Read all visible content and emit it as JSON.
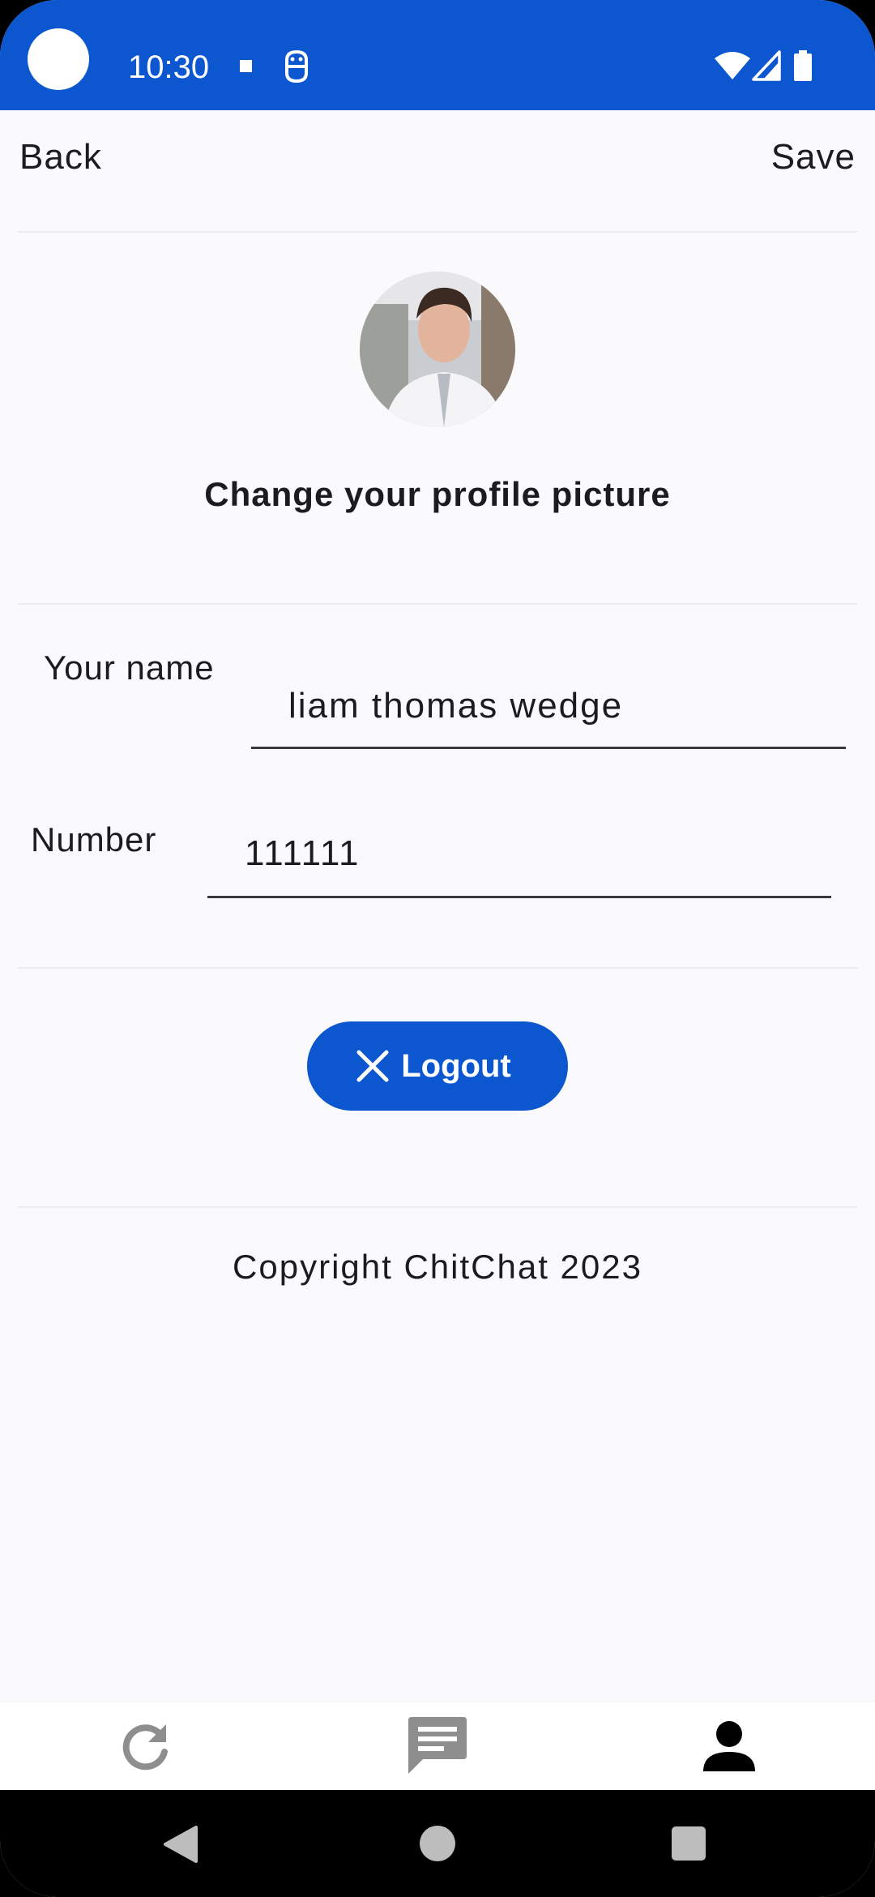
{
  "status_bar": {
    "time": "10:30",
    "color": "#0c57d0",
    "icons": [
      "notification-dot-icon",
      "notification-app-icon",
      "wifi-icon",
      "signal-icon",
      "battery-icon"
    ]
  },
  "header": {
    "back_label": "Back",
    "save_label": "Save"
  },
  "profile": {
    "change_picture_label": "Change your profile picture"
  },
  "form": {
    "name_label": "Your name",
    "name_value": "liam thomas wedge",
    "number_label": "Number",
    "number_value": "111111"
  },
  "logout": {
    "label": "Logout",
    "icon": "close-icon",
    "color": "#0c57d0"
  },
  "footer": {
    "copyright": "Copyright ChitChat 2023"
  },
  "bottom_nav": {
    "items": [
      {
        "icon": "refresh-icon",
        "active": false
      },
      {
        "icon": "chat-icon",
        "active": false
      },
      {
        "icon": "person-icon",
        "active": true
      }
    ]
  },
  "system_nav": {
    "icons": [
      "back-triangle-icon",
      "home-circle-icon",
      "recents-square-icon"
    ]
  }
}
